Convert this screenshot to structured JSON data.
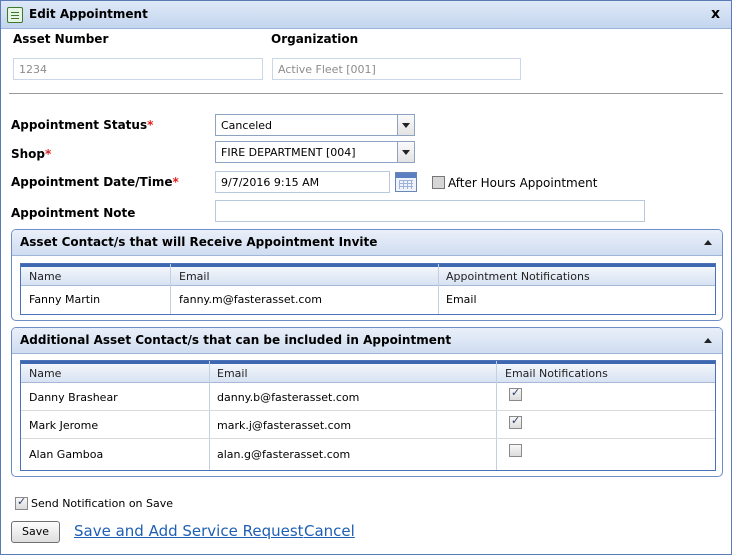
{
  "window": {
    "title": "Edit Appointment",
    "close_glyph": "x"
  },
  "asset": {
    "number_label": "Asset Number",
    "number_value": "1234",
    "org_label": "Organization",
    "org_value": "Active Fleet [001]"
  },
  "form": {
    "status_label": "Appointment Status",
    "status_value": "Canceled",
    "shop_label": "Shop",
    "shop_value": "FIRE DEPARTMENT [004]",
    "datetime_label": "Appointment Date/Time",
    "datetime_value": "9/7/2016 9:15 AM",
    "after_hours_label": "After Hours Appointment",
    "after_hours_checked": false,
    "note_label": "Appointment Note",
    "note_value": "",
    "required_mark": "*"
  },
  "contacts_panel": {
    "title": "Asset Contact/s that will Receive Appointment Invite",
    "columns": [
      "Name",
      "Email",
      "Appointment Notifications"
    ],
    "rows": [
      {
        "name": "Fanny Martin",
        "email": "fanny.m@fasterasset.com",
        "notifications": "Email"
      }
    ]
  },
  "additional_panel": {
    "title": "Additional Asset Contact/s that can be included in Appointment",
    "columns": [
      "Name",
      "Email",
      "Email Notifications"
    ],
    "rows": [
      {
        "name": "Danny Brashear",
        "email": "danny.b@fasterasset.com",
        "checked": true
      },
      {
        "name": "Mark Jerome",
        "email": "mark.j@fasterasset.com",
        "checked": true
      },
      {
        "name": "Alan Gamboa",
        "email": "alan.g@fasterasset.com",
        "checked": false
      }
    ]
  },
  "footer": {
    "send_notification_label": "Send Notification on Save",
    "send_notification_checked": true,
    "save_label": "Save",
    "save_add_label": "Save and Add Service Request",
    "cancel_label": "Cancel"
  },
  "colors": {
    "accent": "#3e67b1",
    "link": "#1f5fb4",
    "required": "#e0201f"
  }
}
